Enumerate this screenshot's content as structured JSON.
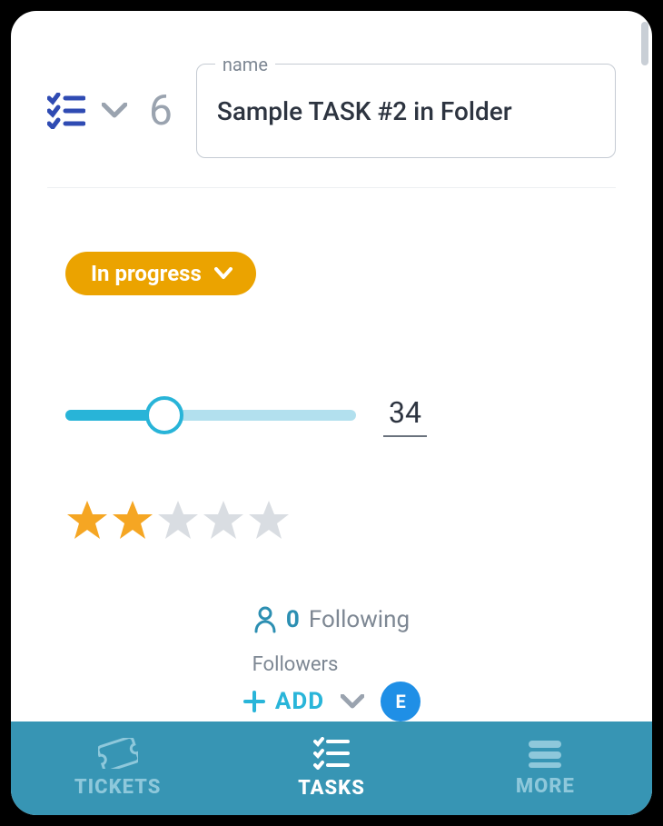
{
  "header": {
    "id_number": "6",
    "name_label": "name",
    "name_value": "Sample TASK #2 in Folder"
  },
  "status": {
    "label": "In progress"
  },
  "progress": {
    "percent": 34,
    "value_display": "34"
  },
  "rating": {
    "value": 2,
    "max": 5
  },
  "following": {
    "count": "0",
    "label": "Following"
  },
  "followers": {
    "section_label": "Followers",
    "add_label": "ADD",
    "avatar_initial": "E"
  },
  "tabbar": {
    "tickets": "TICKETS",
    "tasks": "TASKS",
    "more": "MORE",
    "active": "tasks"
  },
  "colors": {
    "accent_blue": "#28b4d8",
    "status_amber": "#eba300",
    "star_filled": "#f5a623",
    "star_empty": "#d9dde2",
    "tabbar_bg": "#3795b4"
  }
}
